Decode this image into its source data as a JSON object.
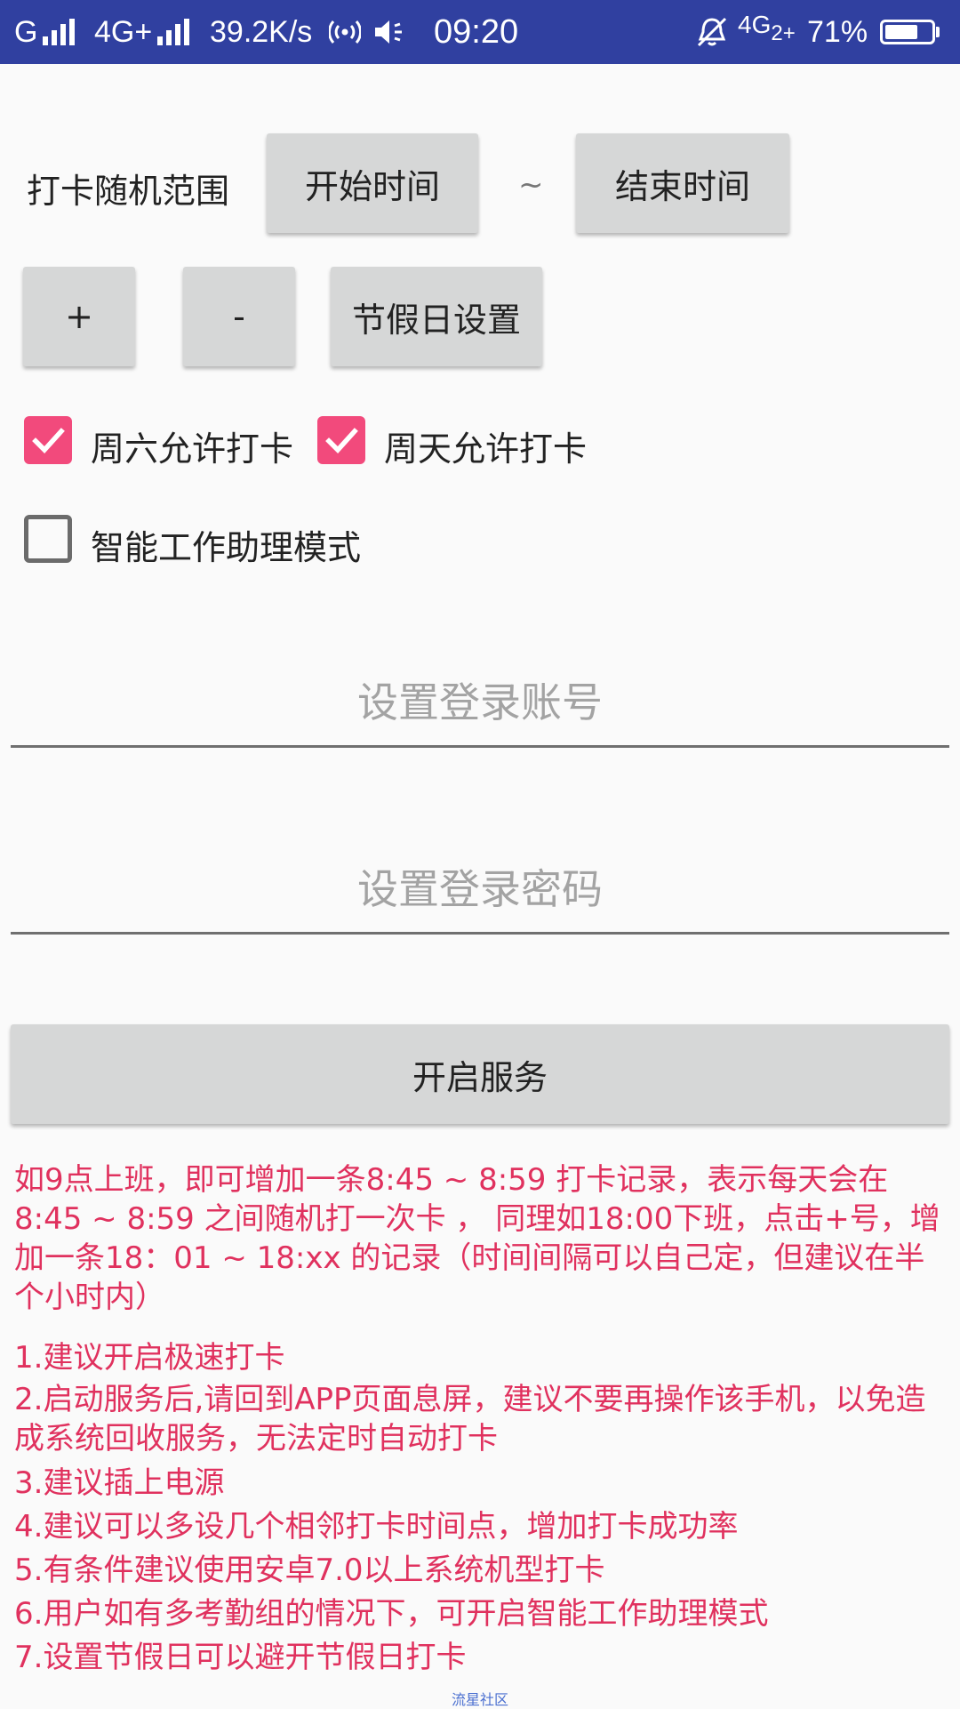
{
  "status_bar": {
    "carrier_left": "G",
    "network_type": "4G+",
    "net_speed": "39.2K/s",
    "time": "09:20",
    "network_type_right": "4G",
    "sim_index": "2+",
    "battery_percent": "71%",
    "battery_level": 0.71,
    "background_color": "#3040a0"
  },
  "range": {
    "label": "打卡随机范围",
    "start_button": "开始时间",
    "separator": "~",
    "end_button": "结束时间"
  },
  "actions": {
    "add": "+",
    "remove": "-",
    "holiday_button": "节假日设置"
  },
  "checkboxes": {
    "saturday": {
      "label": "周六允许打卡",
      "checked": true
    },
    "sunday": {
      "label": "周天允许打卡",
      "checked": true
    },
    "smart_mode": {
      "label": "智能工作助理模式",
      "checked": false
    },
    "accent_color": "#f24a7c"
  },
  "login": {
    "account_placeholder": "设置登录账号",
    "account_value": "",
    "password_placeholder": "设置登录密码",
    "password_value": ""
  },
  "service_button": "开启服务",
  "intro_text": "如9点上班，即可增加一条8:45 ~ 8:59 打卡记录，表示每天会在8:45 ~ 8:59 之间随机打一次卡 ， 同理如18:00下班，点击+号，增加一条18：01 ~ 18:xx 的记录（时间间隔可以自己定，但建议在半个小时内）",
  "tips": [
    "1.建议开启极速打卡",
    "2.启动服务后,请回到APP页面息屏，建议不要再操作该手机，以免造成系统回收服务，无法定时自动打卡",
    "3.建议插上电源",
    "4.建议可以多设几个相邻打卡时间点，增加打卡成功率",
    "5.有条件建议使用安卓7.0以上系统机型打卡",
    "6.用户如有多考勤组的情况下，可开启智能工作助理模式",
    "7.设置节假日可以避开节假日打卡"
  ],
  "text_color": "#e0315e",
  "watermark": "流星社区"
}
